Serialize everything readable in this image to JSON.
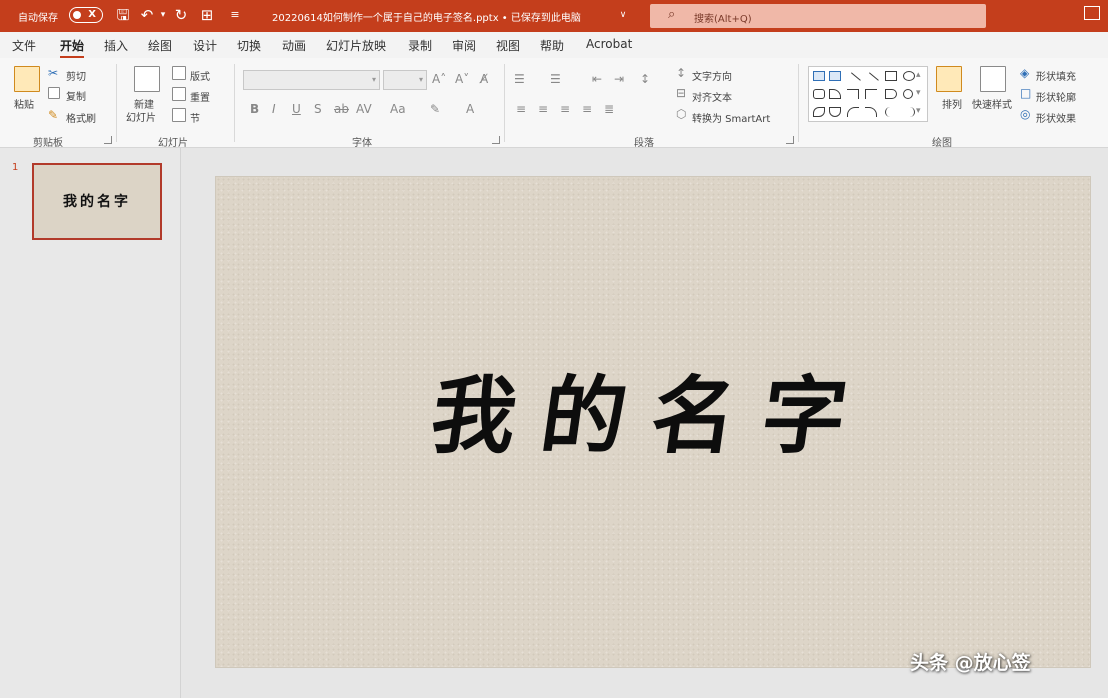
{
  "titlebar": {
    "autosave_label": "自动保存",
    "autosave_state": "X",
    "filename": "20220614如何制作一个属于自己的电子签名.pptx • 已保存到此电脑",
    "search_placeholder": "搜索(Alt+Q)"
  },
  "tabs": [
    "文件",
    "开始",
    "插入",
    "绘图",
    "设计",
    "切换",
    "动画",
    "幻灯片放映",
    "录制",
    "审阅",
    "视图",
    "帮助",
    "Acrobat"
  ],
  "active_tab": "开始",
  "ribbon": {
    "clipboard": {
      "paste": "粘贴",
      "cut": "剪切",
      "copy": "复制",
      "format_painter": "格式刷",
      "group": "剪贴板"
    },
    "slides": {
      "new_slide_line1": "新建",
      "new_slide_line2": "幻灯片",
      "layout": "版式",
      "reset": "重置",
      "section": "节",
      "group": "幻灯片"
    },
    "font": {
      "bold": "B",
      "italic": "I",
      "underline": "U",
      "strike": "S",
      "group": "字体"
    },
    "paragraph": {
      "text_direction": "文字方向",
      "align_text": "对齐文本",
      "smartart": "转换为 SmartArt",
      "group": "段落"
    },
    "drawing": {
      "arrange": "排列",
      "quick_styles": "快速样式",
      "shape_fill": "形状填充",
      "shape_outline": "形状轮廓",
      "shape_effects": "形状效果",
      "group": "绘图"
    }
  },
  "thumbnails": [
    {
      "number": "1",
      "title": "我的名字"
    }
  ],
  "slide": {
    "title": "我的名字"
  },
  "watermark": "头条 @放心签",
  "colors": {
    "accent": "#c43e1c",
    "slide_bg": "#ddd5c8"
  }
}
